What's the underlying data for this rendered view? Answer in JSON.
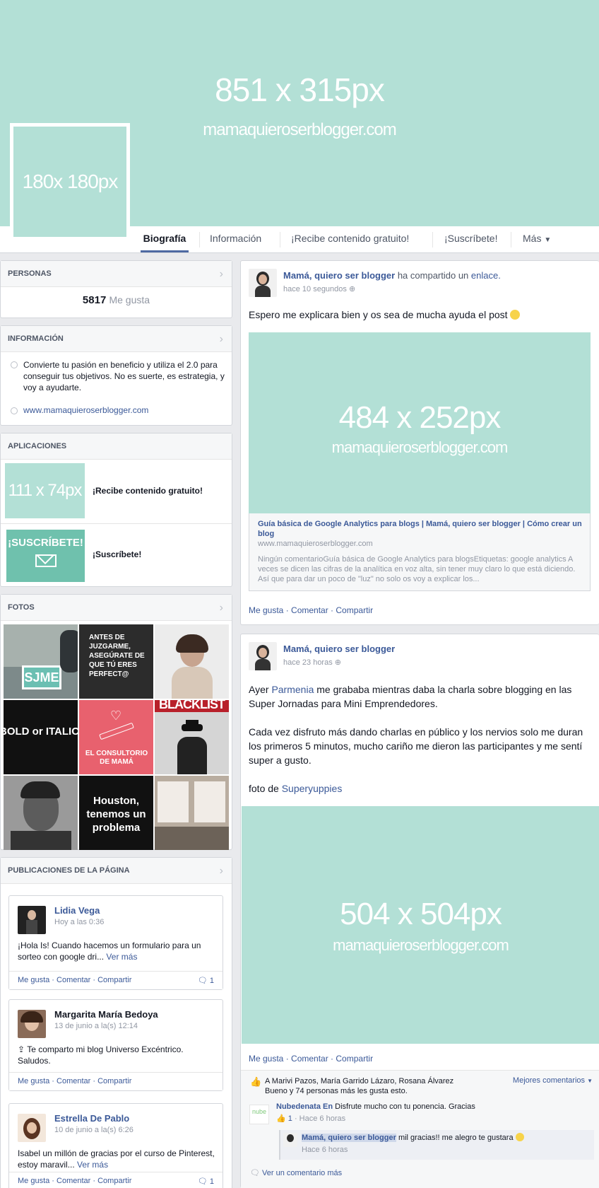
{
  "cover": {
    "size_text": "851 x 315px",
    "url_text": "mamaquieroserblogger.com",
    "profile_text": "180x 180px"
  },
  "nav": {
    "tabs": [
      "Biografía",
      "Información",
      "¡Recibe contenido gratuito!",
      "¡Suscríbete!",
      "Más"
    ]
  },
  "personas": {
    "title": "PERSONAS",
    "count": "5817",
    "likes_label": "Me gusta"
  },
  "info": {
    "title": "INFORMACIÓN",
    "description": "Convierte tu pasión en beneficio y utiliza el 2.0 para conseguir tus objetivos. No es suerte, es estrategia, y voy a ayudarte.",
    "website": "www.mamaquieroserblogger.com"
  },
  "apps": {
    "title": "APLICACIONES",
    "items": [
      {
        "thumb": "111 x 74px",
        "label": "¡Recibe contenido gratuito!"
      },
      {
        "thumb": "¡SUSCRÍBETE!",
        "label": "¡Suscríbete!"
      }
    ]
  },
  "photos": {
    "title": "FOTOS",
    "captions": {
      "p2": "ANTES DE JUZGARME, ASEGÚRATE DE QUE TÚ ERES PERFECT@",
      "p4": "BOLD or ITALIC · NEVER REGULAR.",
      "p5": "EL CONSULTORIO DE MAMÁ",
      "p6": "BLACKLIST",
      "p8": "Houston, tenemos un problema"
    }
  },
  "page_posts": {
    "title": "PUBLICACIONES DE LA PÁGINA",
    "items": [
      {
        "author": "Lidia Vega",
        "time": "Hoy a las 0:36",
        "text": "¡Hola Is! Cuando hacemos un formulario para un sorteo con google dri...",
        "more": "Ver más",
        "count": "1"
      },
      {
        "author": "Margarita María Bedoya",
        "time": "13 de junio a la(s) 12:14",
        "text": "Te comparto mi blog Universo Excéntrico. Saludos."
      },
      {
        "author": "Estrella De Pablo",
        "time": "10 de junio a la(s) 6:26",
        "text": "Isabel un millón de gracias por el curso de Pinterest, estoy maravil...",
        "more": "Ver más",
        "count": "1"
      }
    ],
    "actions": {
      "like": "Me gusta",
      "comment": "Comentar",
      "share": "Compartir"
    }
  },
  "post1": {
    "author": "Mamá, quiero ser blogger",
    "verb": "ha compartido un",
    "object": "enlace.",
    "time": "hace 10 segundos",
    "text": "Espero me explicara bien y os sea de mucha ayuda el post",
    "image_size": "484 x 252px",
    "image_url": "mamaquieroserblogger.com",
    "link_title": "Guía básica de Google Analytics para blogs | Mamá, quiero ser blogger | Cómo crear un blog",
    "link_domain": "www.mamaquieroserblogger.com",
    "link_desc": "Ningún comentarioGuía básica de Google Analytics para blogsEtiquetas: google analytics A veces se dicen las cifras de la analítica en voz alta, sin tener muy claro lo que está diciendo. Así que para dar un poco de \"luz\" no solo os voy a explicar los..."
  },
  "post2": {
    "author": "Mamá, quiero ser blogger",
    "time": "hace 23 horas",
    "text_prefix": "Ayer",
    "text_link": "Parmenia",
    "text_rest": "me grababa mientras daba la charla sobre blogging en las Super Jornadas para Mini Emprendedores.",
    "paragraph2": "Cada vez disfruto más dando charlas en público y los nervios solo me duran los primeros 5 minutos, mucho cariño me dieron las participantes y me sentí super a gusto.",
    "photo_by": "foto de",
    "photo_by_link": "Superyuppies",
    "image_size": "504 x 504px",
    "image_url": "mamaquieroserblogger.com",
    "likes_text": "A Marivi Pazos, María Garrido Lázaro, Rosana Álvarez Bueno y 74 personas más les gusta esto.",
    "top_comments": "Mejores comentarios",
    "comment1_author": "Nubedenata En",
    "comment1_text": "Disfrute mucho con tu ponencia. Gracias",
    "comment1_likes": "1",
    "comment1_time": "Hace 6 horas",
    "reply_author": "Mamá, quiero ser blogger",
    "reply_text": "mil gracias!! me alegro te gustara",
    "reply_time": "Hace 6 horas",
    "more_comments": "Ver un comentario más"
  },
  "post_actions": {
    "like": "Me gusta",
    "comment": "Comentar",
    "share": "Compartir"
  }
}
